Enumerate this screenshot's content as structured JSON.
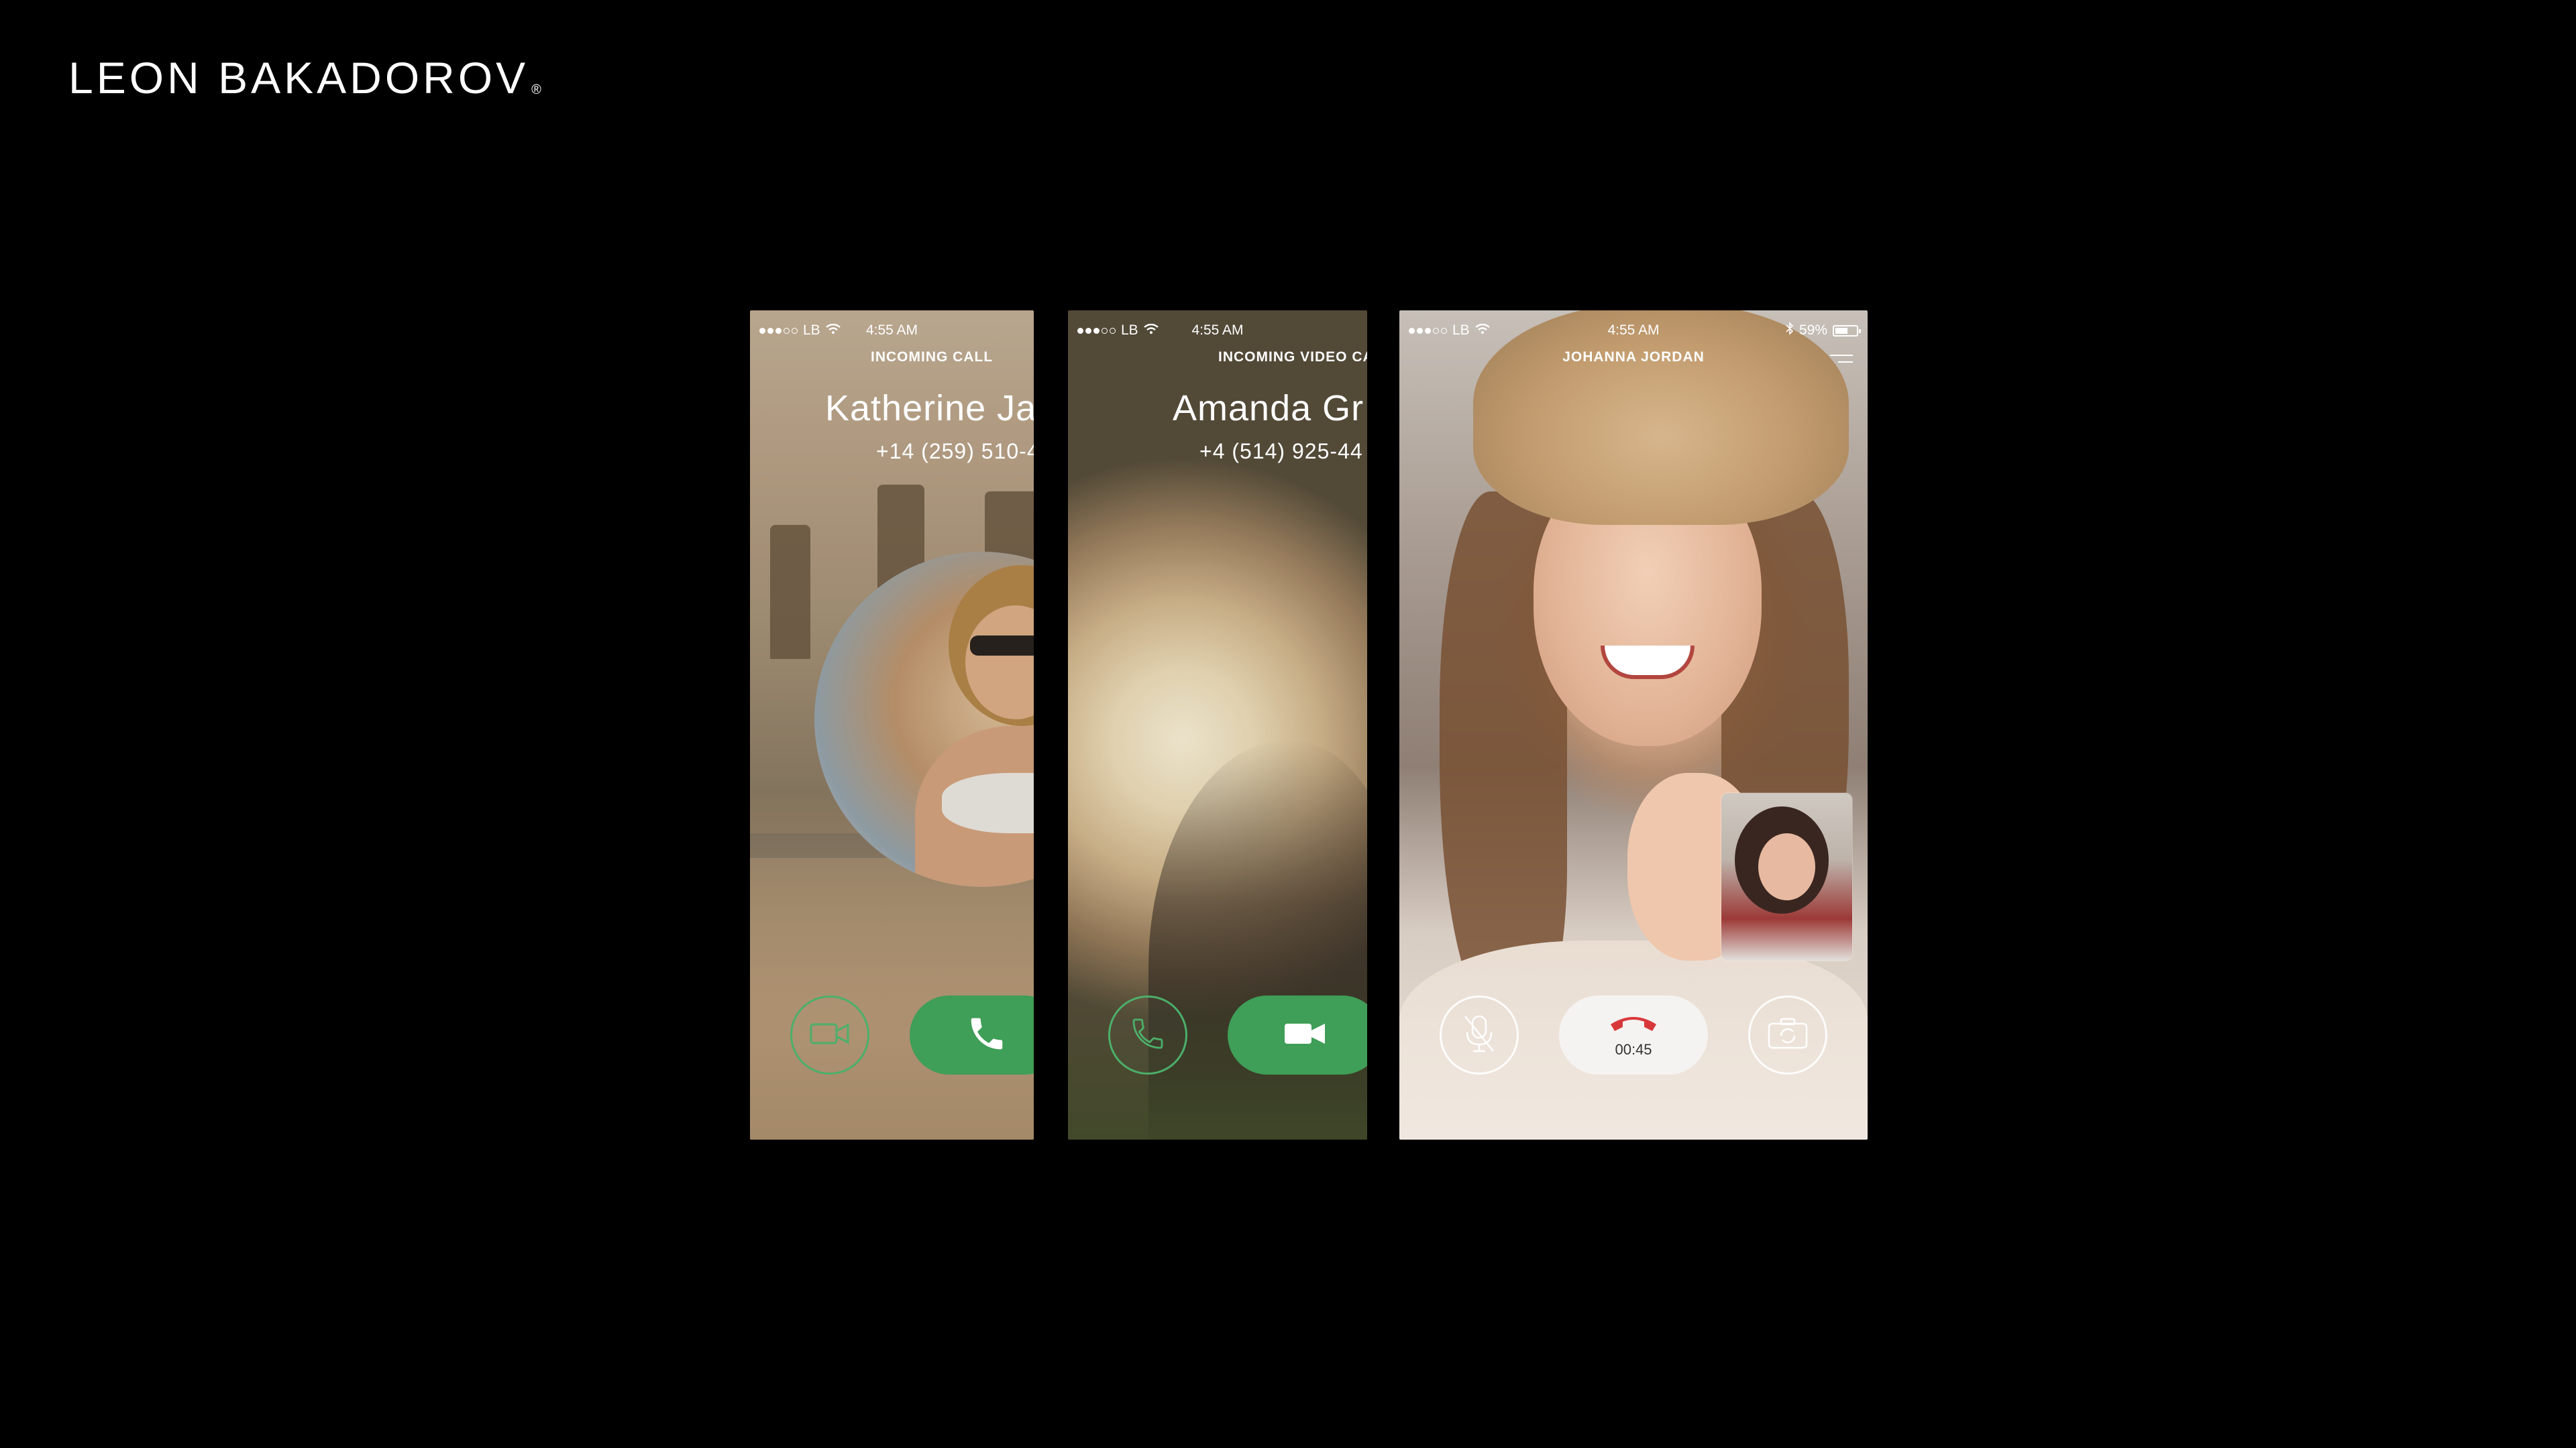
{
  "brand": {
    "name": "LEON BAKADOROV",
    "mark": "®"
  },
  "screens": [
    {
      "status": {
        "carrier": "LB",
        "time": "4:55 AM"
      },
      "call_label": "INCOMING CALL",
      "caller_name": "Katherine Ja",
      "caller_phone": "+14 (259) 510-4",
      "buttons": {
        "secondary": "video-camera-icon",
        "primary": "phone-icon"
      },
      "colors": {
        "accent": "#3f9e57"
      }
    },
    {
      "status": {
        "carrier": "LB",
        "time": "4:55 AM"
      },
      "call_label": "INCOMING VIDEO CA",
      "caller_name": "Amanda Gr",
      "caller_phone": "+4 (514) 925-44",
      "buttons": {
        "secondary": "phone-icon",
        "primary": "video-camera-icon"
      },
      "colors": {
        "accent": "#3f9e57"
      }
    },
    {
      "status": {
        "carrier": "LB",
        "time": "4:55 AM",
        "battery": "59%",
        "battery_level": 0.59
      },
      "call_label": "JOHANNA JORDAN",
      "call_duration": "00:45",
      "buttons": {
        "left": "mute-microphone-icon",
        "center": "end-call-icon",
        "right": "switch-camera-icon"
      },
      "colors": {
        "end_call": "#d8383a"
      }
    }
  ]
}
